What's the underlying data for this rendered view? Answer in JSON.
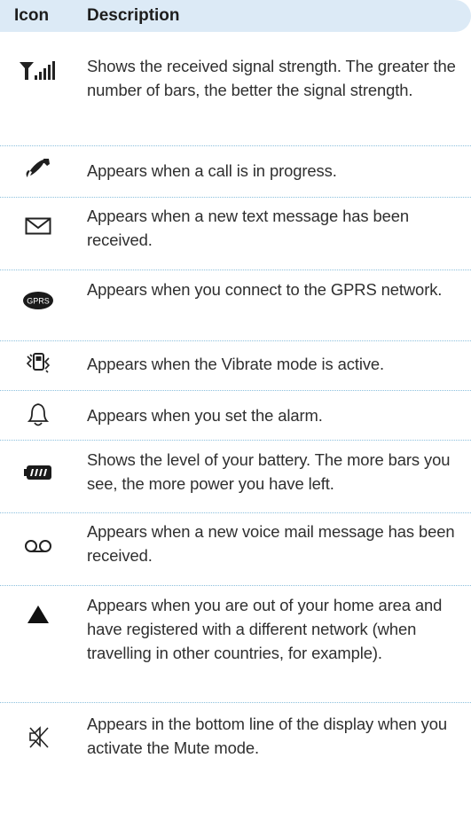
{
  "table": {
    "col_icon": "Icon",
    "col_description": "Description",
    "rows": [
      {
        "icon": "signal-strength-icon",
        "text": "Shows the received signal strength. The greater the number of bars, the better the signal strength."
      },
      {
        "icon": "call-in-progress-icon",
        "text": "Appears when a call is in progress."
      },
      {
        "icon": "envelope-icon",
        "text": "Appears when a new text message has been received."
      },
      {
        "icon": "gprs-icon",
        "text": "Appears when you connect to the GPRS network."
      },
      {
        "icon": "vibrate-icon",
        "text": "Appears when the Vibrate mode is active."
      },
      {
        "icon": "bell-icon",
        "text": "Appears when you set the alarm."
      },
      {
        "icon": "battery-icon",
        "text": "Shows the level of your battery. The more bars you see, the more power you have left."
      },
      {
        "icon": "voicemail-icon",
        "text": "Appears when a new voice mail message has been received."
      },
      {
        "icon": "roaming-triangle-icon",
        "text": "Appears when you are out of your home area and have registered with a different network (when travelling in other countries, for example)."
      },
      {
        "icon": "mute-icon",
        "text": "Appears in the bottom line of the display when you activate the Mute mode."
      }
    ],
    "gprs_label": "GPRS"
  }
}
